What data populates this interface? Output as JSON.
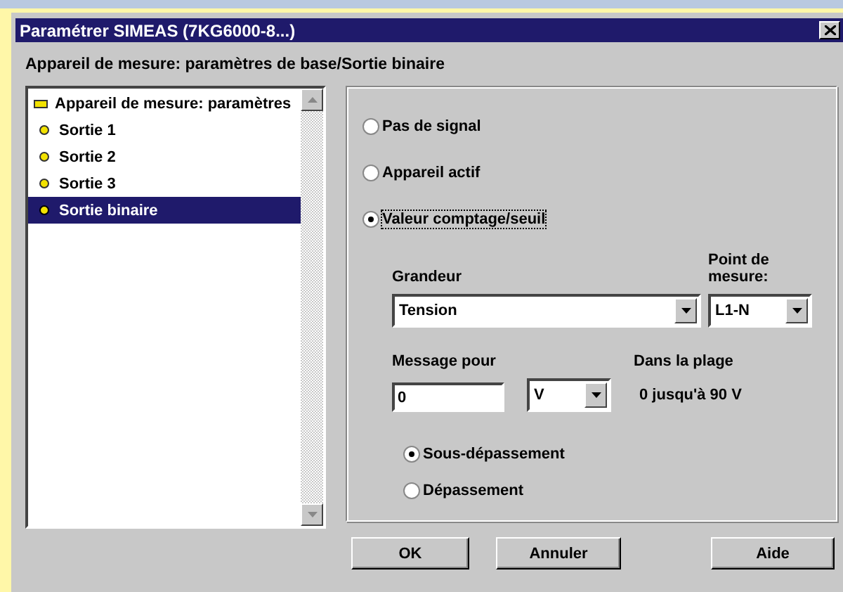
{
  "window": {
    "title": "Paramétrer SIMEAS (7KG6000-8...)"
  },
  "breadcrumb": "Appareil de mesure: paramètres de base/Sortie binaire",
  "tree": {
    "label": "Appareil de mesure: paramètres",
    "children": [
      {
        "label": "Sortie 1",
        "selected": false
      },
      {
        "label": "Sortie 2",
        "selected": false
      },
      {
        "label": "Sortie 3",
        "selected": false
      },
      {
        "label": "Sortie binaire",
        "selected": true
      }
    ]
  },
  "signal_options": [
    {
      "label": "Pas de signal",
      "selected": false
    },
    {
      "label": "Appareil actif",
      "selected": false
    },
    {
      "label": "Valeur comptage/seuil",
      "selected": true
    }
  ],
  "grandeur": {
    "label": "Grandeur",
    "value": "Tension"
  },
  "point_de_mesure": {
    "label": "Point de mesure:",
    "value": "L1-N"
  },
  "message_pour": {
    "label": "Message pour",
    "value": "0",
    "unit": "V"
  },
  "range": {
    "label": "Dans la plage",
    "value": "0 jusqu'à 90 V"
  },
  "direction_options": [
    {
      "label": "Sous-dépassement",
      "selected": true
    },
    {
      "label": "Dépassement",
      "selected": false
    }
  ],
  "buttons": [
    "OK",
    "Annuler",
    "Aide"
  ]
}
